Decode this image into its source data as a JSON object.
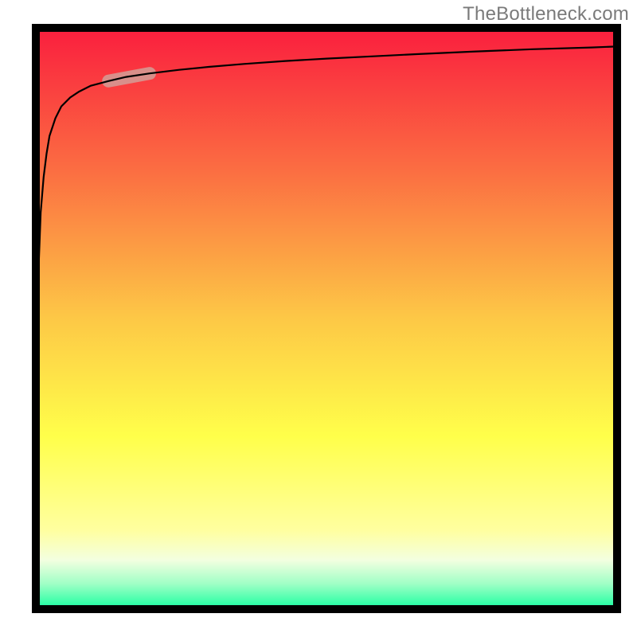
{
  "watermark": {
    "text": "TheBottleneck.com"
  },
  "chart_data": {
    "type": "line",
    "title": "",
    "xlabel": "",
    "ylabel": "",
    "xlim": [
      0,
      100
    ],
    "ylim": [
      0,
      100
    ],
    "background_gradient_stops": [
      {
        "pos": 0.0,
        "color": "#FA1C3E"
      },
      {
        "pos": 0.25,
        "color": "#FB6E42"
      },
      {
        "pos": 0.5,
        "color": "#FDC846"
      },
      {
        "pos": 0.7,
        "color": "#FFFF4A"
      },
      {
        "pos": 0.86,
        "color": "#FFFFA0"
      },
      {
        "pos": 0.91,
        "color": "#F3FFE0"
      },
      {
        "pos": 0.95,
        "color": "#A0FFC6"
      },
      {
        "pos": 1.0,
        "color": "#00FF99"
      }
    ],
    "series": [
      {
        "name": "curve",
        "x": [
          0.6,
          0.6,
          0.8,
          1.0,
          1.2,
          1.5,
          2.0,
          2.5,
          3.0,
          4.0,
          5.0,
          6.5,
          8.0,
          10,
          13,
          16,
          20,
          25,
          30,
          36,
          43,
          50,
          58,
          66,
          75,
          85,
          95,
          100
        ],
        "y": [
          1,
          10,
          35,
          50,
          60,
          68,
          74,
          78,
          81,
          84,
          86,
          87.5,
          88.5,
          89.5,
          90.3,
          91,
          91.6,
          92.2,
          92.7,
          93.2,
          93.7,
          94.1,
          94.5,
          94.9,
          95.3,
          95.7,
          96,
          96.2
        ]
      }
    ],
    "highlight_segment": {
      "x_start": 13,
      "y_start": 90.3,
      "x_end": 20,
      "y_end": 91.6,
      "color": "#D98F8A",
      "thickness_px": 16
    },
    "colors": {
      "frame": "#000000",
      "curve": "#000000"
    }
  }
}
